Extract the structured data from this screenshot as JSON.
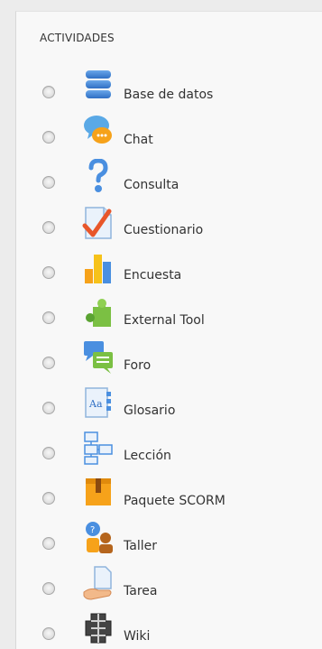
{
  "section": {
    "title": "ACTIVIDADES"
  },
  "activities": [
    {
      "label": "Base de datos",
      "icon": "database-icon"
    },
    {
      "label": "Chat",
      "icon": "chat-bubble-icon"
    },
    {
      "label": "Consulta",
      "icon": "question-mark-icon"
    },
    {
      "label": "Cuestionario",
      "icon": "quiz-checkmark-icon"
    },
    {
      "label": "Encuesta",
      "icon": "bar-chart-icon"
    },
    {
      "label": "External Tool",
      "icon": "puzzle-piece-icon"
    },
    {
      "label": "Foro",
      "icon": "forum-bubbles-icon"
    },
    {
      "label": "Glosario",
      "icon": "glossary-book-icon"
    },
    {
      "label": "Lección",
      "icon": "lesson-flow-icon"
    },
    {
      "label": "Paquete SCORM",
      "icon": "package-box-icon"
    },
    {
      "label": "Taller",
      "icon": "workshop-people-icon"
    },
    {
      "label": "Tarea",
      "icon": "assignment-hand-icon"
    },
    {
      "label": "Wiki",
      "icon": "wiki-puzzle-icon"
    }
  ]
}
